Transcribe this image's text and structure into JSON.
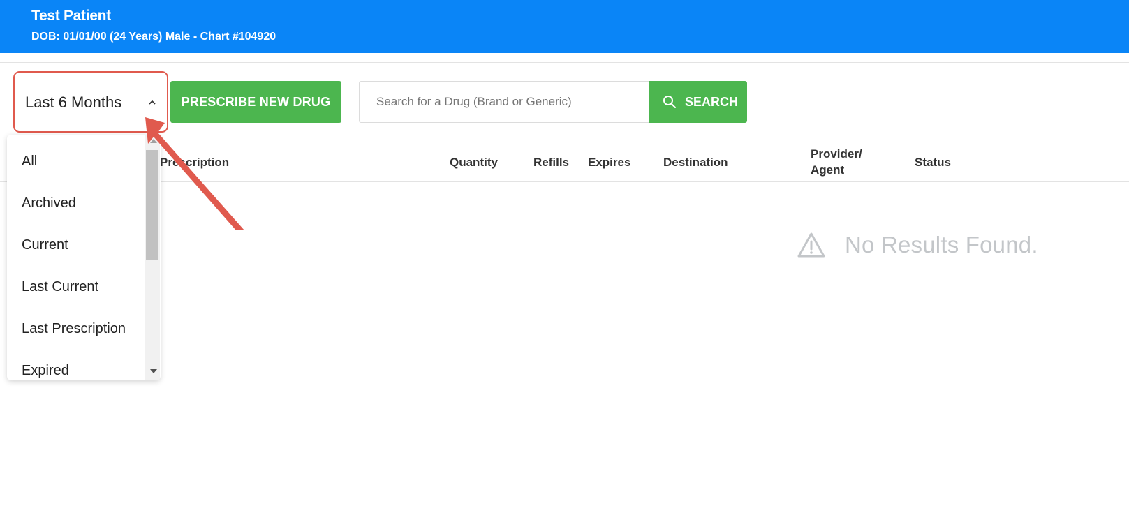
{
  "patient": {
    "name": "Test Patient",
    "info": "DOB: 01/01/00 (24 Years) Male - Chart #104920"
  },
  "toolbar": {
    "filter_value": "Last 6 Months",
    "prescribe_label": "PRESCRIBE NEW DRUG",
    "search_placeholder": "Search for a Drug (Brand or Generic)",
    "search_label": "SEARCH"
  },
  "table": {
    "columns": [
      "Prescription",
      "Quantity",
      "Refills",
      "Expires",
      "Destination",
      "Provider/",
      "Agent",
      "Status"
    ]
  },
  "empty_state": {
    "text": "No Results Found."
  },
  "dropdown": {
    "options": [
      "All",
      "Archived",
      "Current",
      "Last Current",
      "Last Prescription",
      "Expired"
    ]
  },
  "colors": {
    "header_bg": "#0a85f7",
    "primary_button": "#4cb64f",
    "highlight": "#e05a4e"
  }
}
